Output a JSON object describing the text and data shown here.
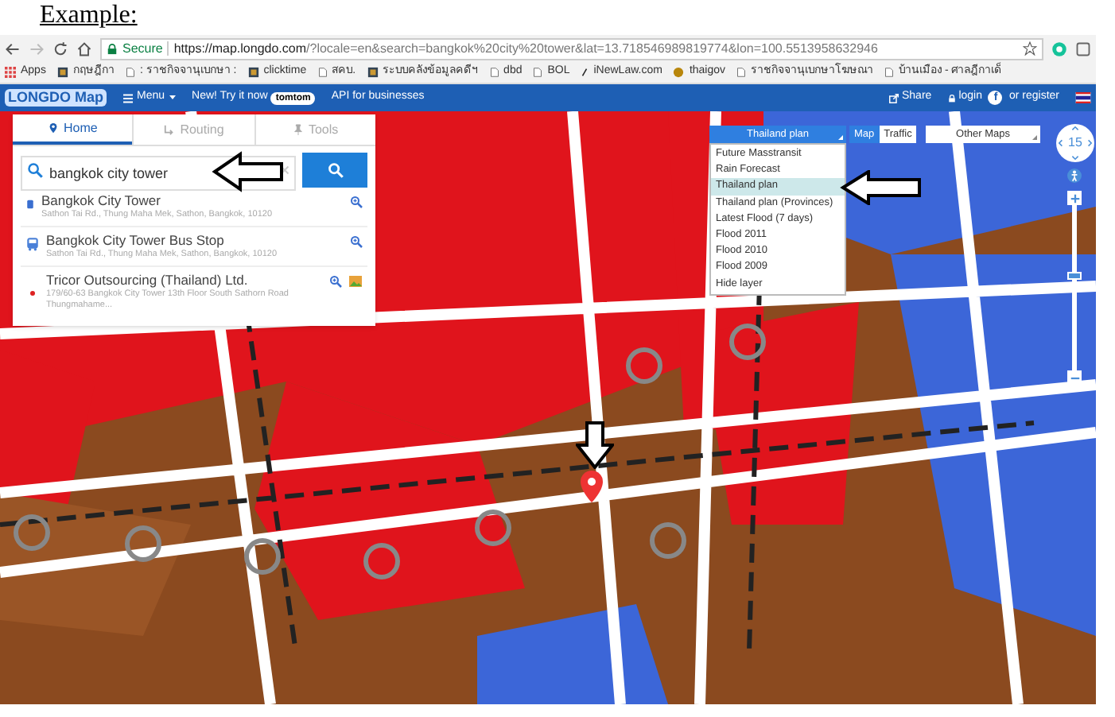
{
  "heading": "Example:",
  "browser": {
    "secure_label": "Secure",
    "url_host": "https://map.longdo.com",
    "url_rest": "/?locale=en&search=bangkok%20city%20tower&lat=13.718546989819774&lon=100.5513958632946"
  },
  "bookmarks": [
    {
      "kind": "apps",
      "label": "Apps"
    },
    {
      "kind": "site",
      "label": "กฤษฎีกา"
    },
    {
      "kind": "page",
      "label": ": ราชกิจจานุเบกษา :"
    },
    {
      "kind": "site",
      "label": "clicktime"
    },
    {
      "kind": "page",
      "label": "สคบ."
    },
    {
      "kind": "site",
      "label": "ระบบคลังข้อมูลคดีฯ"
    },
    {
      "kind": "page",
      "label": "dbd"
    },
    {
      "kind": "page",
      "label": "BOL"
    },
    {
      "kind": "slash",
      "label": "iNewLaw.com"
    },
    {
      "kind": "dot",
      "label": "thaigov"
    },
    {
      "kind": "page",
      "label": "ราชกิจจานุเบกษาโฆษณา"
    },
    {
      "kind": "page",
      "label": "บ้านเมือง - ศาลฎีกาเด็"
    }
  ],
  "navbar": {
    "logo": "LONGDO Map",
    "menu": "Menu",
    "promo": "New! Try it now",
    "promo_badge": "tomtom",
    "api": "API for businesses",
    "share": "Share",
    "login": "login",
    "facebook": "f",
    "register": "or register"
  },
  "panel": {
    "tabs": [
      {
        "label": "Home",
        "selected": true
      },
      {
        "label": "Routing",
        "selected": false
      },
      {
        "label": "Tools",
        "selected": false
      }
    ],
    "search": {
      "value": "bangkok city tower"
    },
    "results": [
      {
        "kind": "building",
        "title": "Bangkok City Tower",
        "address": "Sathon Tai Rd., Thung Maha Mek, Sathon, Bangkok, 10120",
        "has_photo": false
      },
      {
        "kind": "bus",
        "title": "Bangkok City Tower Bus Stop",
        "address": "Sathon Tai Rd., Thung Maha Mek, Sathon, Bangkok, 10120",
        "has_photo": false
      },
      {
        "kind": "point",
        "title": "Tricor Outsourcing (Thailand) Ltd.",
        "address": "179/60-63 Bangkok City Tower 13th Floor South Sathorn Road Thungmahame...",
        "has_photo": true
      }
    ]
  },
  "layer_select": {
    "value": "Thailand plan",
    "options": [
      {
        "label": "Future Masstransit",
        "selected": false
      },
      {
        "label": "Rain Forecast",
        "selected": false
      },
      {
        "label": "Thailand plan",
        "selected": true
      },
      {
        "label": "Thailand plan (Provinces)",
        "selected": false
      },
      {
        "label": "Latest Flood (7 days)",
        "selected": false
      },
      {
        "label": "Flood 2011",
        "selected": false
      },
      {
        "label": "Flood 2010",
        "selected": false
      },
      {
        "label": "Flood 2009",
        "selected": false
      },
      {
        "label": "Hide layer",
        "selected": false
      }
    ]
  },
  "map_types": [
    {
      "label": "Map",
      "selected": true
    },
    {
      "label": "Traffic",
      "selected": false
    }
  ],
  "other_maps": "Other Maps",
  "zoom": {
    "value": "15",
    "level": 0.55
  }
}
